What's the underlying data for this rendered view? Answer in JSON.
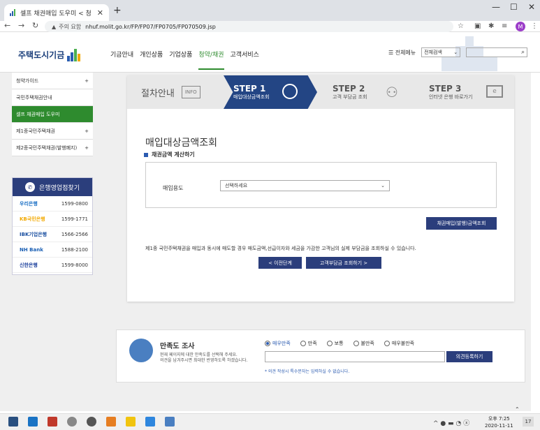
{
  "browser": {
    "tab_title": "셀프 채권매입 도우미 < 청",
    "security_label": "주의 요함",
    "url": "nhuf.molit.go.kr/FP/FP07/FP0705/FP070509.jsp",
    "avatar_letter": "M"
  },
  "header": {
    "logo_text": "주택도시기금",
    "nav": [
      "기금안내",
      "개인상품",
      "기업상품",
      "청약/채권",
      "고객서비스"
    ],
    "active_nav": "청약/채권",
    "all_menu": "☰ 전체메뉴",
    "search_scope": "전체검색"
  },
  "sidebar": {
    "items": [
      {
        "label": "청약가이드",
        "plus": "+"
      },
      {
        "label": "국민주택채권안내",
        "plus": ""
      },
      {
        "label": "셀프 채권매입 도우미",
        "plus": ""
      },
      {
        "label": "제1종국민주택채권",
        "plus": "+"
      },
      {
        "label": "제2종국민주택채권(발행폐지)",
        "plus": "+"
      }
    ],
    "bank_title": "은행영업점찾기",
    "banks": [
      {
        "name": "우리은행",
        "phone": "1599-0800",
        "color": "#1a6fc4"
      },
      {
        "name": "KB국민은행",
        "phone": "1599-1771",
        "color": "#f2a900"
      },
      {
        "name": "IBK기업은행",
        "phone": "1566-2566",
        "color": "#1a4fa0"
      },
      {
        "name": "NH Bank",
        "phone": "1588-2100",
        "color": "#1a5fb4"
      },
      {
        "name": "신한은행",
        "phone": "1599-8000",
        "color": "#1a3f9c"
      }
    ]
  },
  "steps": {
    "intro": "절차안내",
    "intro_icon": "INFO",
    "step1_title": "STEP 1",
    "step1_sub": "매입대상금액조회",
    "step2_title": "STEP 2",
    "step2_sub": "고객 부담금 조회",
    "step3_title": "STEP 3",
    "step3_sub": "인터넷 은행 바로가기"
  },
  "form": {
    "title": "매입대상금액조회",
    "subtitle": "채권금액 계산하기",
    "purpose_label": "매입용도",
    "purpose_placeholder": "선택하세요",
    "calc_button": "채권매입(발행)금액조회",
    "note": "제1종 국민주택채권을 매입과 동시에 매도할 경우 매도금액,선급이자와 세금을 가감한 고객님의 실제 부담금을 조회하실 수 있습니다.",
    "prev_button": "<  이전단계",
    "next_button": "고객부담금 조회하기  >"
  },
  "survey": {
    "title": "만족도 조사",
    "desc1": "현재 페이지에 대한 만족도를 선택해 주세요.",
    "desc2": "의견을 남겨주시면 최대한 반영하도록 하겠습니다.",
    "options": [
      "매우만족",
      "만족",
      "보통",
      "불만족",
      "매우불만족"
    ],
    "selected": "매우만족",
    "submit": "의견등록하기",
    "hint": "* 의견 작성시 특수문자는 입력하실 수 없습니다."
  },
  "taskbar": {
    "time": "오후 7:25",
    "date": "2020-11-11",
    "notif_count": "17"
  }
}
